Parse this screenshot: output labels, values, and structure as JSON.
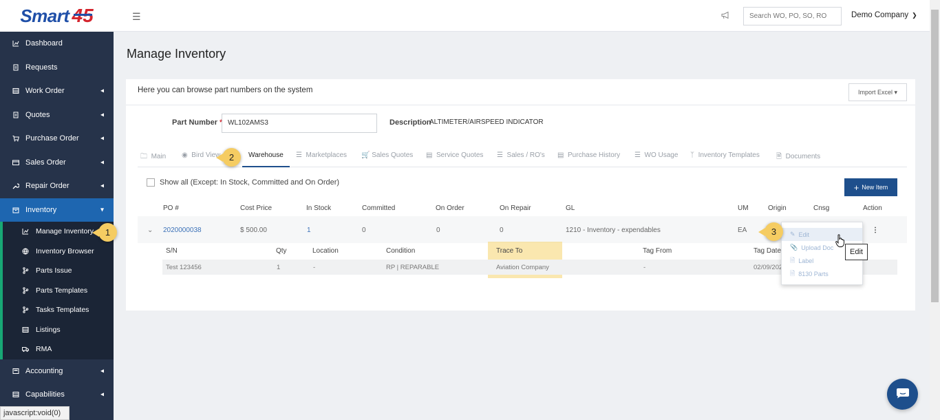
{
  "logo": {
    "text": "Smart",
    "num": "45"
  },
  "sidebar": {
    "items": [
      {
        "label": "Dashboard",
        "icon": "chart-icon"
      },
      {
        "label": "Requests",
        "icon": "document-icon"
      },
      {
        "label": "Work Order",
        "icon": "list-icon",
        "expandable": true
      },
      {
        "label": "Quotes",
        "icon": "document-icon",
        "expandable": true
      },
      {
        "label": "Purchase Order",
        "icon": "cart-icon",
        "expandable": true
      },
      {
        "label": "Sales Order",
        "icon": "card-icon",
        "expandable": true
      },
      {
        "label": "Repair Order",
        "icon": "wrench-icon",
        "expandable": true
      },
      {
        "label": "Inventory",
        "icon": "box-icon",
        "expanded": true
      },
      {
        "label": "Accounting",
        "icon": "calculator-icon",
        "expandable": true
      },
      {
        "label": "Capabilities",
        "icon": "list-icon",
        "expandable": true
      }
    ],
    "inventory_sub": [
      {
        "label": "Manage Inventory",
        "icon": "chart-icon"
      },
      {
        "label": "Inventory Browser",
        "icon": "globe-icon"
      },
      {
        "label": "Parts Issue",
        "icon": "branch-icon"
      },
      {
        "label": "Parts Templates",
        "icon": "branch-icon"
      },
      {
        "label": "Tasks Templates",
        "icon": "branch-icon"
      },
      {
        "label": "Listings",
        "icon": "list-icon"
      },
      {
        "label": "RMA",
        "icon": "truck-icon"
      }
    ]
  },
  "topbar": {
    "search_placeholder": "Search WO, PO, SO, RO",
    "company": "Demo Company"
  },
  "page": {
    "title": "Manage Inventory"
  },
  "card": {
    "intro": "Here you can browse part numbers on the system",
    "import_label": "Import Excel",
    "part_number_label": "Part Number",
    "required_mark": "*",
    "part_number_value": "WL102AMS3",
    "description_label": "Description",
    "description_value": "ALTIMETER/AIRSPEED INDICATOR"
  },
  "tabs": [
    {
      "label": "Main",
      "icon": "folder-icon"
    },
    {
      "label": "Bird View",
      "icon": "eye-icon"
    },
    {
      "label": "Warehouse",
      "icon": "",
      "active": true
    },
    {
      "label": "Marketplaces",
      "icon": "list-icon"
    },
    {
      "label": "Sales Quotes",
      "icon": "cart-icon"
    },
    {
      "label": "Service Quotes",
      "icon": "calculator-icon"
    },
    {
      "label": "Sales / RO's",
      "icon": "list-icon"
    },
    {
      "label": "Purchase History",
      "icon": "card-icon"
    },
    {
      "label": "WO Usage",
      "icon": "list-icon"
    },
    {
      "label": "Inventory Templates",
      "icon": "branch-icon"
    },
    {
      "label": "Documents",
      "icon": "document-icon"
    }
  ],
  "warehouse": {
    "show_all_label": "Show all (Except: In Stock, Committed and On Order)",
    "new_item_label": "New Item",
    "columns": [
      "PO #",
      "Cost Price",
      "In Stock",
      "Committed",
      "On Order",
      "On Repair",
      "GL",
      "UM",
      "Origin",
      "Cnsg",
      "Action"
    ],
    "row": {
      "po": "2020000038",
      "cost": "$ 500.00",
      "in_stock": "1",
      "committed": "0",
      "on_order": "0",
      "on_repair": "0",
      "gl": "1210 - Inventory - expendables",
      "um": "EA"
    },
    "sub_columns": [
      "S/N",
      "Qty",
      "Location",
      "Condition",
      "Trace To",
      "Tag From",
      "Tag Date"
    ],
    "sub_row": {
      "sn": "Test 123456",
      "qty": "1",
      "location": "-",
      "condition": "RP | REPARABLE",
      "trace_to": "Aviation Company",
      "tag_from": "-",
      "tag_date": "02/09/202"
    }
  },
  "action_menu": {
    "items": [
      "Edit",
      "Upload Doc",
      "Label",
      "8130 Parts"
    ],
    "tooltip": "Edit"
  },
  "badges": [
    "1",
    "2",
    "3"
  ],
  "status_bar": "javascript:void(0)"
}
